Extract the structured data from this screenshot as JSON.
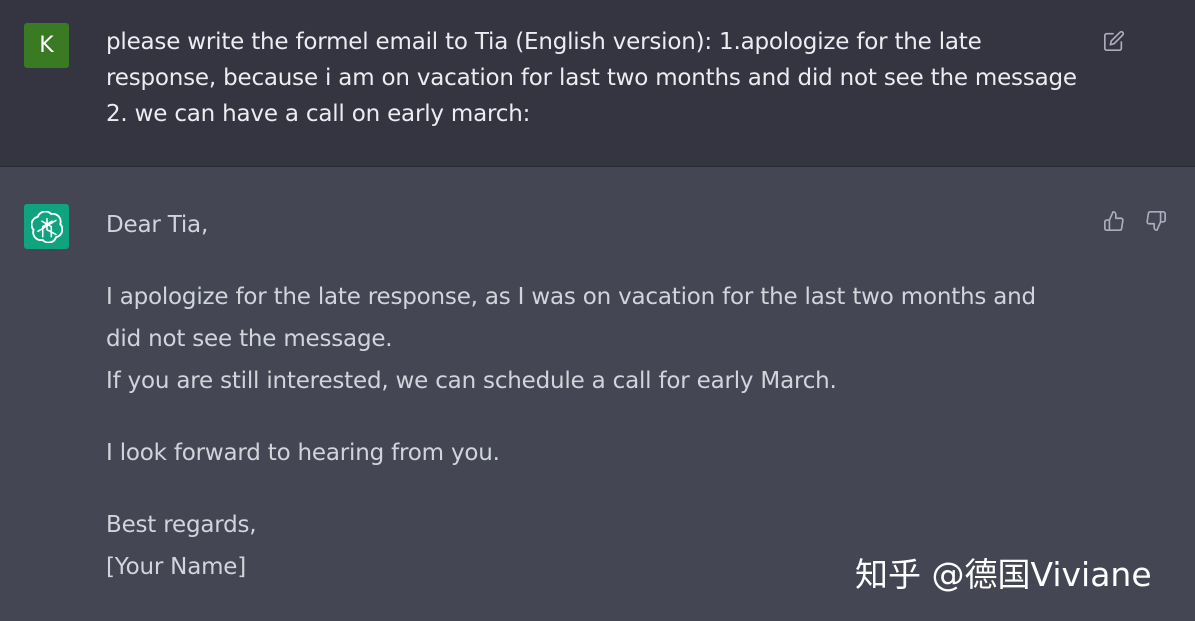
{
  "user": {
    "avatar_letter": "K",
    "message": "please write the formel email to Tia (English version): 1.apologize for the late response, because i am on vacation for last two months and did not see the message 2. we can have a call on early march:"
  },
  "assistant": {
    "greeting": "Dear Tia,",
    "line1": "I apologize for the late response, as I was on vacation for the last two months and",
    "line2": "did not see the message.",
    "line3": "If you are still interested, we can schedule a call for early March.",
    "line4": "I look forward to hearing from you.",
    "closing": "Best regards,",
    "signature": "[Your Name]"
  },
  "watermark": "知乎 @德国Viviane",
  "icons": {
    "edit": "edit-icon",
    "thumbs_up": "thumbs-up-icon",
    "thumbs_down": "thumbs-down-icon",
    "bot": "openai-logo-icon"
  },
  "colors": {
    "user_bg": "#343541",
    "assistant_bg": "#444654",
    "user_avatar": "#3a7a22",
    "bot_avatar": "#10a37f"
  }
}
